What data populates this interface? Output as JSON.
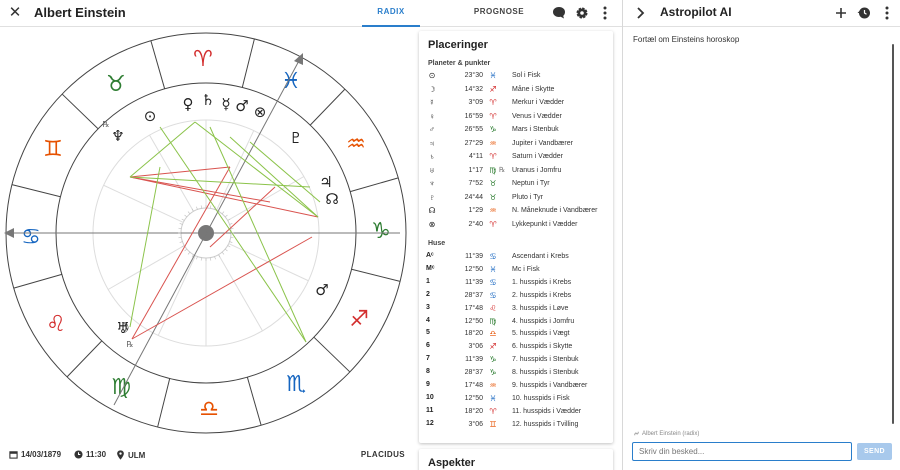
{
  "header": {
    "title": "Albert Einstein",
    "tabs": [
      {
        "label": "RADIX",
        "active": true
      },
      {
        "label": "PROGNOSE",
        "active": false
      }
    ],
    "icons": [
      "close-icon",
      "chat-icon",
      "gear-icon",
      "more-vert-icon"
    ]
  },
  "chart": {
    "signs": [
      "♈",
      "♉",
      "♊",
      "♋",
      "♌",
      "♍",
      "♎",
      "♏",
      "♐",
      "♑",
      "♒",
      "♓"
    ],
    "sign_colors": [
      "#d32f2f",
      "#2e7d32",
      "#e65100",
      "#1565c0",
      "#d32f2f",
      "#2e7d32",
      "#e65100",
      "#1565c0",
      "#d32f2f",
      "#2e7d32",
      "#e65100",
      "#1565c0"
    ],
    "ascendant_label": "",
    "planet_glyphs": [
      {
        "glyph": "♀",
        "name": "venus"
      },
      {
        "glyph": "♄",
        "name": "saturn"
      },
      {
        "glyph": "☿",
        "name": "mercury"
      },
      {
        "glyph": "♂",
        "name": "mars"
      },
      {
        "glyph": "⊗",
        "name": "fortune"
      },
      {
        "glyph": "⊙",
        "name": "sun"
      },
      {
        "glyph": "♆",
        "name": "neptune"
      },
      {
        "glyph": "♇",
        "name": "pluto"
      },
      {
        "glyph": "♃",
        "name": "jupiter"
      },
      {
        "glyph": "☊",
        "name": "node"
      },
      {
        "glyph": "♂",
        "name": "mars-2"
      },
      {
        "glyph": "☽",
        "name": "moon"
      },
      {
        "glyph": "♅",
        "name": "uranus"
      }
    ],
    "retrograde_marks": [
      "℞",
      "℞"
    ]
  },
  "footer": {
    "date": "14/03/1879",
    "time": "11:30",
    "place": "ULM",
    "house_system": "PLACIDUS",
    "icons": [
      "calendar-icon",
      "clock-icon",
      "pin-icon"
    ]
  },
  "placements": {
    "title": "Placeringer",
    "planets_heading": "Planeter & punkter",
    "planets": [
      {
        "sym": "⊙",
        "deg": "23°30",
        "sign": "♓",
        "sign_color": "#1565c0",
        "retro": "",
        "desc": "Sol i Fisk"
      },
      {
        "sym": "☽",
        "deg": "14°32",
        "sign": "♐",
        "sign_color": "#d32f2f",
        "retro": "",
        "desc": "Måne i Skytte"
      },
      {
        "sym": "☿",
        "deg": "3°09",
        "sign": "♈",
        "sign_color": "#d32f2f",
        "retro": "",
        "desc": "Merkur i Vædder"
      },
      {
        "sym": "♀",
        "deg": "16°59",
        "sign": "♈",
        "sign_color": "#d32f2f",
        "retro": "",
        "desc": "Venus i Vædder"
      },
      {
        "sym": "♂",
        "deg": "26°55",
        "sign": "♑",
        "sign_color": "#2e7d32",
        "retro": "",
        "desc": "Mars i Stenbuk"
      },
      {
        "sym": "♃",
        "deg": "27°29",
        "sign": "♒",
        "sign_color": "#e65100",
        "retro": "",
        "desc": "Jupiter i Vandbærer"
      },
      {
        "sym": "♄",
        "deg": "4°11",
        "sign": "♈",
        "sign_color": "#d32f2f",
        "retro": "",
        "desc": "Saturn i Vædder"
      },
      {
        "sym": "♅",
        "deg": "1°17",
        "sign": "♍",
        "sign_color": "#2e7d32",
        "retro": "℞",
        "desc": "Uranus i Jomfru"
      },
      {
        "sym": "♆",
        "deg": "7°52",
        "sign": "♉",
        "sign_color": "#2e7d32",
        "retro": "",
        "desc": "Neptun i Tyr"
      },
      {
        "sym": "♇",
        "deg": "24°44",
        "sign": "♉",
        "sign_color": "#2e7d32",
        "retro": "",
        "desc": "Pluto i Tyr"
      },
      {
        "sym": "☊",
        "deg": "1°29",
        "sign": "♒",
        "sign_color": "#e65100",
        "retro": "",
        "desc": "N. Måneknude i Vandbærer"
      },
      {
        "sym": "⊗",
        "deg": "2°40",
        "sign": "♈",
        "sign_color": "#d32f2f",
        "retro": "",
        "desc": "Lykkepunkt i Vædder"
      }
    ],
    "houses_heading": "Huse",
    "houses": [
      {
        "sym": "Aᶜ",
        "deg": "11°39",
        "sign": "♋",
        "sign_color": "#1565c0",
        "desc": "Ascendant i Krebs"
      },
      {
        "sym": "Mᶜ",
        "deg": "12°50",
        "sign": "♓",
        "sign_color": "#1565c0",
        "desc": "Mc i Fisk"
      },
      {
        "sym": "1",
        "deg": "11°39",
        "sign": "♋",
        "sign_color": "#1565c0",
        "desc": "1. husspids i Krebs"
      },
      {
        "sym": "2",
        "deg": "28°37",
        "sign": "♋",
        "sign_color": "#1565c0",
        "desc": "2. husspids i Krebs"
      },
      {
        "sym": "3",
        "deg": "17°48",
        "sign": "♌",
        "sign_color": "#d32f2f",
        "desc": "3. husspids i Løve"
      },
      {
        "sym": "4",
        "deg": "12°50",
        "sign": "♍",
        "sign_color": "#2e7d32",
        "desc": "4. husspids i Jomfru"
      },
      {
        "sym": "5",
        "deg": "18°20",
        "sign": "♎",
        "sign_color": "#e65100",
        "desc": "5. husspids i Vægt"
      },
      {
        "sym": "6",
        "deg": "3°06",
        "sign": "♐",
        "sign_color": "#d32f2f",
        "desc": "6. husspids i Skytte"
      },
      {
        "sym": "7",
        "deg": "11°39",
        "sign": "♑",
        "sign_color": "#2e7d32",
        "desc": "7. husspids i Stenbuk"
      },
      {
        "sym": "8",
        "deg": "28°37",
        "sign": "♑",
        "sign_color": "#2e7d32",
        "desc": "8. husspids i Stenbuk"
      },
      {
        "sym": "9",
        "deg": "17°48",
        "sign": "♒",
        "sign_color": "#e65100",
        "desc": "9. husspids i Vandbærer"
      },
      {
        "sym": "10",
        "deg": "12°50",
        "sign": "♓",
        "sign_color": "#1565c0",
        "desc": "10. husspids i Fisk"
      },
      {
        "sym": "11",
        "deg": "18°20",
        "sign": "♈",
        "sign_color": "#d32f2f",
        "desc": "11. husspids i Vædder"
      },
      {
        "sym": "12",
        "deg": "3°06",
        "sign": "♊",
        "sign_color": "#e65100",
        "desc": "12. husspids i Tvilling"
      }
    ]
  },
  "aspects": {
    "title": "Aspekter"
  },
  "ai": {
    "title": "Astropilot AI",
    "icons": [
      "chevron-right-icon",
      "plus-icon",
      "history-icon",
      "more-vert-icon"
    ],
    "message": "Fortæl om Einsteins horoskop",
    "context_label": "Albert Einstein (radix)",
    "input_placeholder": "Skriv din besked...",
    "send_label": "SEND"
  }
}
